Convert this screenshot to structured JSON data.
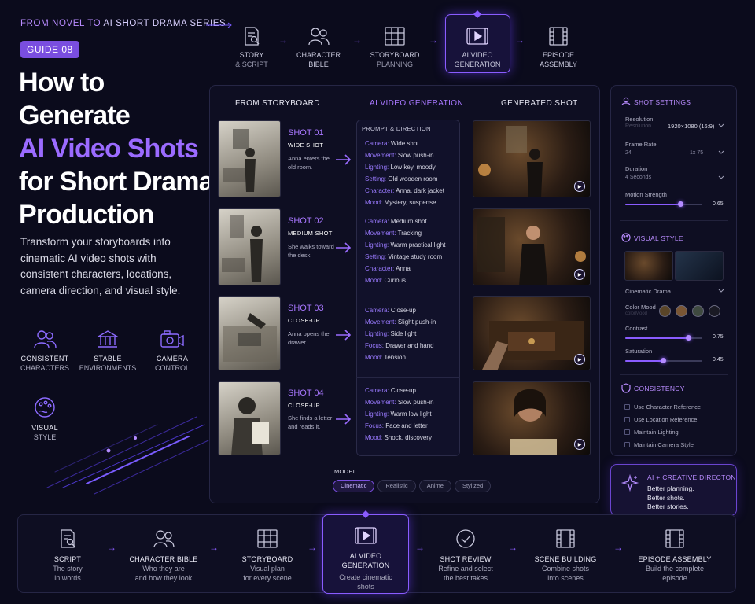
{
  "header": {
    "eyebrow_a": "FROM NOVEL TO",
    "eyebrow_b": "AI SHORT DRAMA SERIES",
    "guide_badge": "GUIDE 08",
    "title_l1": "How to",
    "title_l2": "Generate",
    "title_l3": "AI Video Shots",
    "title_l4": "for Short Drama",
    "title_l5": "Production",
    "intro": "Transform your storyboards into cinematic AI video shots with consistent characters, locations, camera direction, and visual style."
  },
  "features": [
    {
      "l1": "CONSISTENT",
      "l2": "CHARACTERS",
      "icon": "people-icon"
    },
    {
      "l1": "STABLE",
      "l2": "ENVIRONMENTS",
      "icon": "building-icon"
    },
    {
      "l1": "CAMERA",
      "l2": "CONTROL",
      "icon": "camera-icon"
    },
    {
      "l1": "VISUAL",
      "l2": "STYLE",
      "icon": "palette-icon"
    }
  ],
  "top_steps": [
    {
      "l1": "STORY",
      "l2": "& SCRIPT",
      "icon": "script-icon"
    },
    {
      "l1": "CHARACTER",
      "l2": "BIBLE",
      "icon": "people-icon"
    },
    {
      "l1": "STORYBOARD",
      "l2": "PLANNING",
      "icon": "grid-icon"
    },
    {
      "l1": "AI VIDEO",
      "l2": "GENERATION",
      "icon": "video-icon"
    },
    {
      "l1": "EPISODE",
      "l2": "ASSEMBLY",
      "icon": "film-icon"
    }
  ],
  "columns": {
    "storyboard": "FROM STORYBOARD",
    "generation": "AI VIDEO GENERATION",
    "generated": "GENERATED SHOT"
  },
  "prompt_header": "PROMPT & DIRECTION",
  "shots": [
    {
      "label": "SHOT 01",
      "type": "WIDE SHOT",
      "desc": "Anna enters the old room.",
      "prompt": [
        [
          "Camera:",
          "Wide shot"
        ],
        [
          "Movement:",
          "Slow push-in"
        ],
        [
          "Lighting:",
          "Low key, moody"
        ],
        [
          "Setting:",
          "Old wooden room"
        ],
        [
          "Character:",
          "Anna, dark jacket"
        ],
        [
          "Mood:",
          "Mystery, suspense"
        ]
      ]
    },
    {
      "label": "SHOT 02",
      "type": "MEDIUM SHOT",
      "desc": "She walks toward the desk.",
      "prompt": [
        [
          "Camera:",
          "Medium shot"
        ],
        [
          "Movement:",
          "Tracking"
        ],
        [
          "Lighting:",
          "Warm practical light"
        ],
        [
          "Setting:",
          "Vintage study room"
        ],
        [
          "Character:",
          "Anna"
        ],
        [
          "Mood:",
          "Curious"
        ]
      ]
    },
    {
      "label": "SHOT 03",
      "type": "CLOSE-UP",
      "desc": "Anna opens the drawer.",
      "prompt": [
        [
          "Camera:",
          "Close-up"
        ],
        [
          "Movement:",
          "Slight push-in"
        ],
        [
          "Lighting:",
          "Side light"
        ],
        [
          "Focus:",
          "Drawer and hand"
        ],
        [
          "Mood:",
          "Tension"
        ]
      ]
    },
    {
      "label": "SHOT 04",
      "type": "CLOSE-UP",
      "desc": "She finds a letter and reads it.",
      "prompt": [
        [
          "Camera:",
          "Close-up"
        ],
        [
          "Movement:",
          "Slow push-in"
        ],
        [
          "Lighting:",
          "Warm low light"
        ],
        [
          "Focus:",
          "Face and letter"
        ],
        [
          "Mood:",
          "Shock, discovery"
        ]
      ]
    }
  ],
  "model": {
    "label": "MODEL",
    "options": [
      "Cinematic",
      "Realistic",
      "Anime",
      "Stylized"
    ],
    "selected": "Cinematic"
  },
  "settings": {
    "header": "SHOT SETTINGS",
    "resolution_label": "Resolution",
    "resolution_sub": "Resolution",
    "resolution_value": "1920×1080 (16:9)",
    "frame_rate_label": "Frame Rate",
    "frame_rate_value": "24",
    "frame_rate_unit": "1x 75",
    "duration_label": "Duration",
    "duration_value": "4 Seconds",
    "motion_label": "Motion Strength",
    "motion_value": "0.65",
    "visual_header": "VISUAL STYLE",
    "style_value": "Cinematic Drama",
    "color_mood_label": "Color Mood",
    "color_mood_sub": "colorMood",
    "mood_colors": [
      "#5a4528",
      "#7a5634",
      "#3f4a40",
      "#1a1a24"
    ],
    "contrast_label": "Contrast",
    "contrast_value": "0.75",
    "saturation_label": "Saturation",
    "saturation_value": "0.45",
    "consistency_header": "CONSISTENCY",
    "checks": [
      "Use Character Reference",
      "Use Location Reference",
      "Maintain Lighting",
      "Maintain Camera Style"
    ]
  },
  "creative": {
    "header": "AI + CREATIVE DIRECTON",
    "l1": "Better planning.",
    "l2": "Better shots.",
    "l3": "Better stories."
  },
  "bottom_steps": [
    {
      "t": "SCRIPT",
      "d1": "The story",
      "d2": "in words",
      "icon": "script-icon"
    },
    {
      "t": "CHARACTER BIBLE",
      "d1": "Who they are",
      "d2": "and how they look",
      "icon": "people-icon"
    },
    {
      "t": "STORYBOARD",
      "d1": "Visual plan",
      "d2": "for every scene",
      "icon": "grid-icon"
    },
    {
      "t": "AI VIDEO",
      "t2": "GENERATION",
      "d1": "Create cinematic",
      "d2": "shots",
      "icon": "video-icon"
    },
    {
      "t": "SHOT REVIEW",
      "d1": "Refine and select",
      "d2": "the best takes",
      "icon": "check-icon"
    },
    {
      "t": "SCENE BUILDING",
      "d1": "Combine shots",
      "d2": "into scenes",
      "icon": "film-icon"
    },
    {
      "t": "EPISODE ASSEMBLY",
      "d1": "Build the complete",
      "d2": "episode",
      "icon": "film-icon"
    }
  ],
  "colors": {
    "accent": "#8a5cff",
    "background": "#0b0b1c",
    "highlight": "#9b6bff"
  }
}
